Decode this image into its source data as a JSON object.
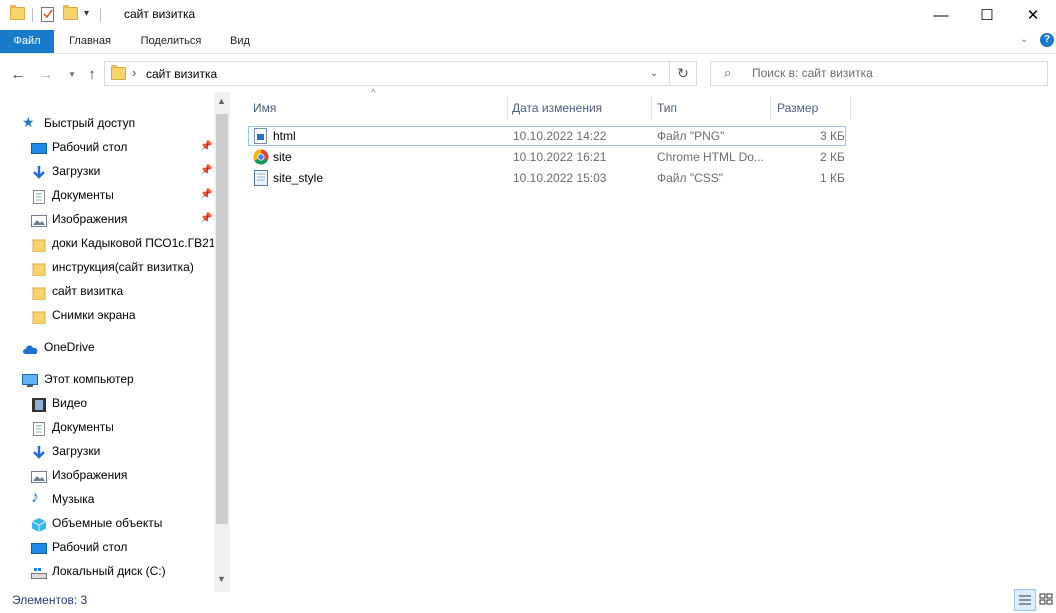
{
  "window": {
    "title": "сайт визитка",
    "minimize": "—",
    "maximize": "☐",
    "close": "✕"
  },
  "ribbon": {
    "tabs": [
      "Файл",
      "Главная",
      "Поделиться",
      "Вид"
    ],
    "expand_icon": "chevron-down-icon",
    "help_icon": "help-icon"
  },
  "address": {
    "path": "сайт визитка",
    "separator": "›"
  },
  "search": {
    "placeholder": "Поиск в: сайт визитка"
  },
  "nav": {
    "quick_access": "Быстрый доступ",
    "quick_items": [
      {
        "label": "Рабочий стол",
        "icon": "desktop-icon",
        "pinned": true
      },
      {
        "label": "Загрузки",
        "icon": "downloads-icon",
        "pinned": true
      },
      {
        "label": "Документы",
        "icon": "documents-icon",
        "pinned": true
      },
      {
        "label": "Изображения",
        "icon": "pictures-icon",
        "pinned": true
      },
      {
        "label": "доки Кадыковой ПСО1с.ГВ21",
        "icon": "folder-icon",
        "pinned": false
      },
      {
        "label": "инструкция(сайт визитка)",
        "icon": "folder-icon",
        "pinned": false
      },
      {
        "label": "сайт визитка",
        "icon": "folder-icon",
        "pinned": false
      },
      {
        "label": "Снимки экрана",
        "icon": "folder-icon",
        "pinned": false
      }
    ],
    "onedrive": "OneDrive",
    "this_pc": "Этот компьютер",
    "pc_items": [
      {
        "label": "Видео",
        "icon": "video-icon"
      },
      {
        "label": "Документы",
        "icon": "documents-icon"
      },
      {
        "label": "Загрузки",
        "icon": "downloads-icon"
      },
      {
        "label": "Изображения",
        "icon": "pictures-icon"
      },
      {
        "label": "Музыка",
        "icon": "music-icon"
      },
      {
        "label": "Объемные объекты",
        "icon": "3d-objects-icon"
      },
      {
        "label": "Рабочий стол",
        "icon": "desktop-icon"
      },
      {
        "label": "Локальный диск (C:)",
        "icon": "drive-icon"
      }
    ]
  },
  "columns": {
    "name": "Имя",
    "date": "Дата изменения",
    "type": "Тип",
    "size": "Размер"
  },
  "files": [
    {
      "name": "html",
      "date": "10.10.2022 14:22",
      "type": "Файл \"PNG\"",
      "size": "3 КБ",
      "icon": "png-file-icon"
    },
    {
      "name": "site",
      "date": "10.10.2022 16:21",
      "type": "Chrome HTML Do...",
      "size": "2 КБ",
      "icon": "chrome-icon"
    },
    {
      "name": "site_style",
      "date": "10.10.2022 15:03",
      "type": "Файл \"CSS\"",
      "size": "1 КБ",
      "icon": "css-file-icon"
    }
  ],
  "status": {
    "text": "Элементов: 3"
  },
  "colors": {
    "accent": "#1979ca",
    "selection_border": "#99c7ef",
    "column_header": "#4c607a",
    "folder": "#f6d36b"
  }
}
